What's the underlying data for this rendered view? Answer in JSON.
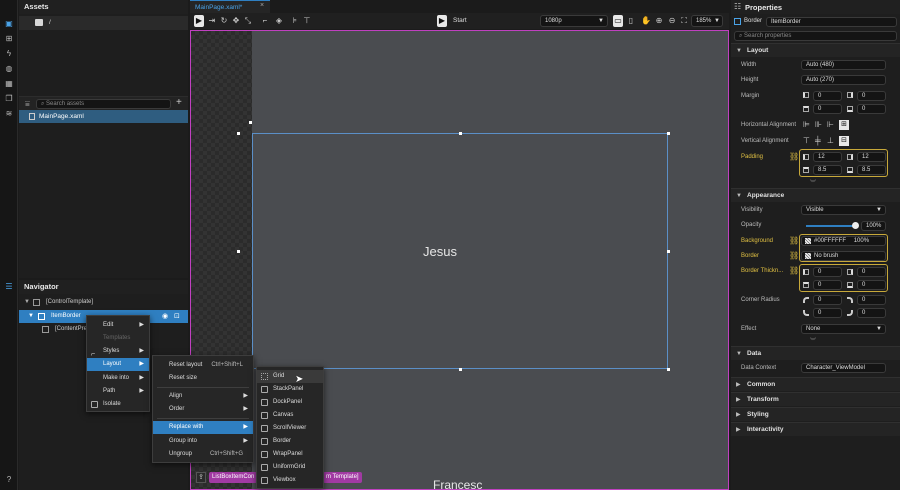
{
  "assets": {
    "title": "Assets",
    "folder": "/",
    "search_placeholder": "Search assets",
    "files": [
      "MainPage.xaml"
    ]
  },
  "navigator": {
    "title": "Navigator",
    "rows": [
      "[ControlTemplate]",
      "ItemBorder",
      "[ContentPre"
    ]
  },
  "document": {
    "tab": "MainPage.xaml*",
    "start_label": "Start",
    "resolution": "1080p",
    "zoom": "185%",
    "canvas_text_main": "Jesus",
    "canvas_text_bottom": "Francesc",
    "breadcrumb_1": "ListBoxItemCon",
    "breadcrumb_2": "m Template]"
  },
  "context_menu": {
    "items": [
      {
        "label": "Edit",
        "has_submenu": true
      },
      {
        "label": "Templates",
        "disabled": true
      },
      {
        "label": "Styles",
        "has_submenu": true
      },
      {
        "label": "Layout",
        "has_submenu": true,
        "selected": true
      },
      {
        "label": "Make into",
        "has_submenu": true
      },
      {
        "label": "Path",
        "has_submenu": true
      },
      {
        "label": "Isolate"
      }
    ]
  },
  "layout_menu": {
    "items": [
      {
        "label": "Reset layout",
        "shortcut": "Ctrl+Shift+L"
      },
      {
        "label": "Reset size",
        "shortcut": ""
      },
      {
        "label": "Align",
        "has_submenu": true
      },
      {
        "label": "Order",
        "has_submenu": true
      },
      {
        "label": "Replace with",
        "has_submenu": true,
        "selected": true
      },
      {
        "label": "Group into",
        "has_submenu": true
      },
      {
        "label": "Ungroup",
        "shortcut": "Ctrl+Shift+G"
      }
    ]
  },
  "replace_menu": {
    "items": [
      "Grid",
      "StackPanel",
      "DockPanel",
      "Canvas",
      "ScrollViewer",
      "Border",
      "WrapPanel",
      "UniformGrid",
      "Viewbox"
    ]
  },
  "properties": {
    "title": "Properties",
    "element_type": "Border",
    "element_name": "ItemBorder",
    "search_placeholder": "Search properties",
    "sections": {
      "layout": "Layout",
      "appearance": "Appearance",
      "data": "Data",
      "common": "Common",
      "transform": "Transform",
      "styling": "Styling",
      "interactivity": "Interactivity"
    },
    "layout": {
      "width_label": "Width",
      "width_value": "Auto (480)",
      "height_label": "Height",
      "height_value": "Auto (270)",
      "margin_label": "Margin",
      "margin": [
        "0",
        "0",
        "0",
        "0"
      ],
      "halign_label": "Horizontal Alignment",
      "valign_label": "Vertical Alignment",
      "padding_label": "Padding",
      "padding": [
        "12",
        "12",
        "8.5",
        "8.5"
      ]
    },
    "appearance": {
      "visibility_label": "Visibility",
      "visibility_value": "Visible",
      "opacity_label": "Opacity",
      "opacity_value": "100%",
      "opacity_fraction": 1.0,
      "background_label": "Background",
      "background_value": "#00FFFFFF",
      "background_pct": "100%",
      "border_label": "Border",
      "border_value": "No brush",
      "border_thickness_label": "Border Thickn...",
      "border_thickness": [
        "0",
        "0",
        "0",
        "0"
      ],
      "corner_radius_label": "Corner Radius",
      "corner_radius": [
        "0",
        "0",
        "0",
        "0"
      ],
      "effect_label": "Effect",
      "effect_value": "None"
    },
    "data": {
      "context_label": "Data Context",
      "context_value": "Character_ViewModel"
    }
  },
  "colors": {
    "accent": "#2f7fc1",
    "highlight": "#e0c043",
    "selection_magenta": "#c040c0"
  }
}
